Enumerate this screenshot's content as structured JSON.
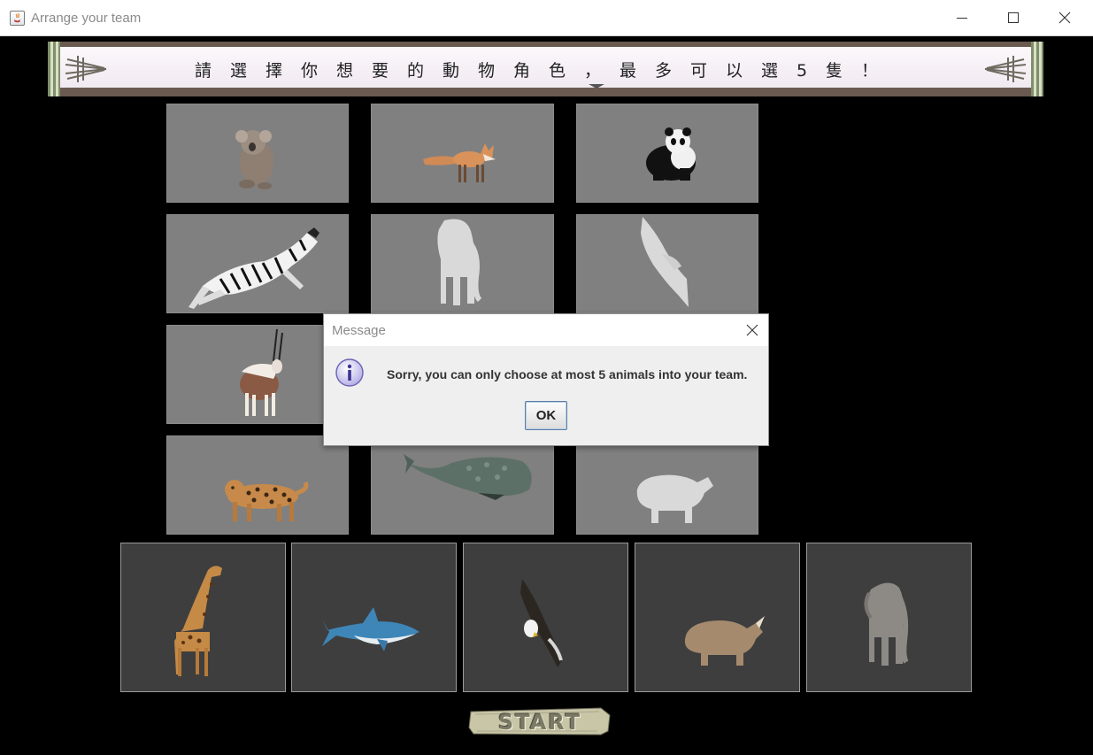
{
  "window": {
    "title": "Arrange your team",
    "minimize_label": "minimize",
    "maximize_label": "maximize",
    "close_label": "close"
  },
  "banner": {
    "text": "請選擇你想要的動物角色，最多可以選5隻！"
  },
  "animal_grid": {
    "tiles": [
      {
        "animal": "koala",
        "state": "available"
      },
      {
        "animal": "fox",
        "state": "available"
      },
      {
        "animal": "panda",
        "state": "available"
      },
      {
        "animal": "zebra",
        "state": "available"
      },
      {
        "animal": "elephant",
        "state": "selected"
      },
      {
        "animal": "eagle",
        "state": "selected"
      },
      {
        "animal": "oryx",
        "state": "available"
      },
      {
        "animal": "unknown",
        "state": "hidden-by-dialog"
      },
      {
        "animal": "unknown",
        "state": "hidden-by-dialog"
      },
      {
        "animal": "leopard",
        "state": "available"
      },
      {
        "animal": "sperm-whale",
        "state": "available"
      },
      {
        "animal": "rhinoceros",
        "state": "selected"
      }
    ]
  },
  "team": {
    "slots": [
      {
        "animal": "giraffe"
      },
      {
        "animal": "shark"
      },
      {
        "animal": "eagle"
      },
      {
        "animal": "rhinoceros"
      },
      {
        "animal": "elephant"
      }
    ]
  },
  "start_button": {
    "label": "START"
  },
  "dialog": {
    "title": "Message",
    "icon": "info-icon",
    "message": "Sorry, you can only choose at most 5 animals into your team.",
    "ok_label": "OK"
  },
  "colors": {
    "tile_background": "#808080",
    "team_slot_background": "#3e3e3e",
    "selected_silhouette": "#d9d9d9"
  }
}
